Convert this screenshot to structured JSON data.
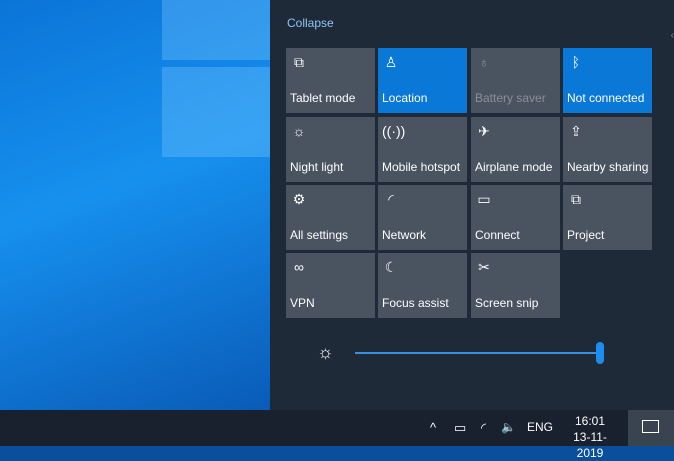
{
  "action_center": {
    "collapse_label": "Collapse",
    "tiles": [
      {
        "label": "Tablet mode",
        "icon": "tablet-mode-icon",
        "glyph": "⧉",
        "state": "off"
      },
      {
        "label": "Location",
        "icon": "location-icon",
        "glyph": "♙",
        "state": "on"
      },
      {
        "label": "Battery saver",
        "icon": "battery-saver-icon",
        "glyph": "♁",
        "state": "disabled"
      },
      {
        "label": "Not connected",
        "icon": "bluetooth-icon",
        "glyph": "ᛒ",
        "state": "on"
      },
      {
        "label": "Night light",
        "icon": "night-light-icon",
        "glyph": "☼",
        "state": "off"
      },
      {
        "label": "Mobile hotspot",
        "icon": "mobile-hotspot-icon",
        "glyph": "((·))",
        "state": "off"
      },
      {
        "label": "Airplane mode",
        "icon": "airplane-icon",
        "glyph": "✈",
        "state": "off"
      },
      {
        "label": "Nearby sharing",
        "icon": "nearby-sharing-icon",
        "glyph": "⇪",
        "state": "off"
      },
      {
        "label": "All settings",
        "icon": "gear-icon",
        "glyph": "⚙",
        "state": "off"
      },
      {
        "label": "Network",
        "icon": "network-icon",
        "glyph": "◜",
        "state": "off"
      },
      {
        "label": "Connect",
        "icon": "connect-icon",
        "glyph": "▭",
        "state": "off"
      },
      {
        "label": "Project",
        "icon": "project-icon",
        "glyph": "⧉",
        "state": "off"
      },
      {
        "label": "VPN",
        "icon": "vpn-icon",
        "glyph": "∞",
        "state": "off"
      },
      {
        "label": "Focus assist",
        "icon": "moon-icon",
        "glyph": "☾",
        "state": "off"
      },
      {
        "label": "Screen snip",
        "icon": "screen-snip-icon",
        "glyph": "✂",
        "state": "off"
      }
    ],
    "brightness": {
      "icon": "brightness-icon",
      "glyph": "☼",
      "value_percent": 100
    }
  },
  "taskbar": {
    "chevron": "^",
    "battery": "▭",
    "wifi": "◜",
    "volume": "🔈",
    "language": "ENG",
    "time": "16:01",
    "date": "13-11-2019"
  }
}
